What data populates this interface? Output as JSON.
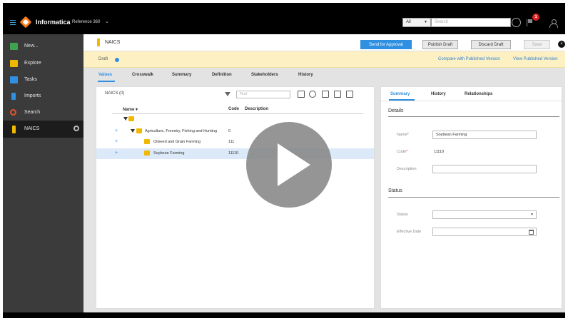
{
  "topbar": {
    "app_name": "Informatica",
    "app_sub": "Reference 360",
    "search_scope": "All",
    "search_placeholder": "Search",
    "notification_count": "1"
  },
  "sidebar": {
    "items": [
      {
        "label": "New...",
        "icon": "plus-box-icon",
        "color": "#3fa34d"
      },
      {
        "label": "Explore",
        "icon": "folder-icon",
        "color": "#f0b800"
      },
      {
        "label": "Tasks",
        "icon": "tasks-icon",
        "color": "#2f8fe0"
      },
      {
        "label": "Imports",
        "icon": "imports-icon",
        "color": "#2f8fe0"
      },
      {
        "label": "Search",
        "icon": "search-icon",
        "color": "#e8542a"
      },
      {
        "label": "NAICS",
        "icon": "codelist-icon",
        "color": "#f0b800"
      }
    ]
  },
  "header": {
    "title": "NAICS",
    "buttons": {
      "send": "Send for Approval",
      "publish": "Publish Draft",
      "discard": "Discard Draft",
      "save": "Save"
    }
  },
  "draft": {
    "label": "Draft",
    "compare_link": "Compare with Published Version",
    "view_link": "View Published Version"
  },
  "tabs": [
    "Values",
    "Crosswalk",
    "Summary",
    "Definition",
    "Stakeholders",
    "History"
  ],
  "left_panel": {
    "title": "NAICS (0)",
    "find_placeholder": "Find",
    "columns": {
      "name": "Name",
      "code": "Code",
      "description": "Description"
    },
    "rows": [
      {
        "name": "Agriculture, Forestry, Fishing and Hunting",
        "code": "0"
      },
      {
        "name": "Oilseed and Grain Farming",
        "code": "111"
      },
      {
        "name": "Soybean Farming",
        "code": "11110"
      }
    ]
  },
  "right_panel": {
    "tabs": [
      "Summary",
      "History",
      "Relationships"
    ],
    "details_title": "Details",
    "name_label": "Name",
    "name_value": "Soybean Farming",
    "code_label": "Code",
    "code_value": "11110",
    "description_label": "Description",
    "status_title": "Status",
    "status_label": "Status",
    "effective_label": "Effective Date"
  }
}
